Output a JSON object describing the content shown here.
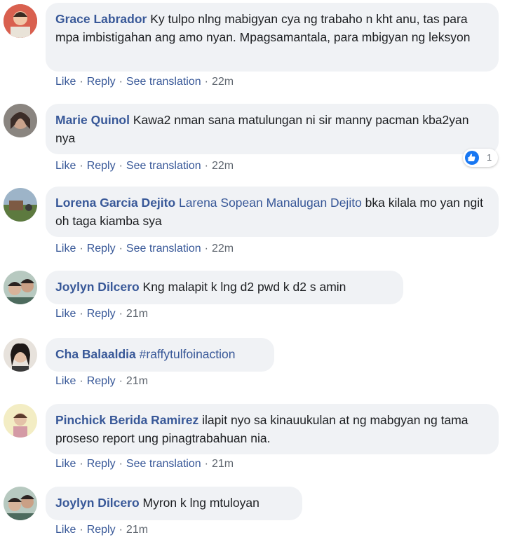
{
  "actions": {
    "like": "Like",
    "reply": "Reply",
    "see_translation": "See translation"
  },
  "comments": [
    {
      "author": "Grace Labrador",
      "text": "Ky tulpo nlng mabigyan cya ng trabaho n kht anu, tas para mpa imbistigahan ang amo nyan. Mpagsamantala, para mbigyan ng leksyon",
      "time": "22m"
    },
    {
      "author": "Marie Quinol",
      "text": "Kawa2 nman sana matulungan ni sir manny pacman kba2yan nya",
      "time": "22m",
      "reaction_count": "1"
    },
    {
      "author": "Lorena Garcia Dejito",
      "tagged": "Larena Sopean Manalugan Dejito",
      "text": "bka kilala mo yan ngit oh taga kiamba sya",
      "time": "22m"
    },
    {
      "author": "Joylyn Dilcero",
      "text": "Kng malapit k lng d2 pwd k d2 s amin",
      "time": "21m"
    },
    {
      "author": "Cha Balaaldia",
      "tagged": "#raffytulfoinaction",
      "time": "21m"
    },
    {
      "author": "Pinchick Berida Ramirez",
      "text": "ilapit nyo sa kinauukulan at ng mabgyan ng tama proseso report ung pinagtrabahuan nia.",
      "time": "21m"
    },
    {
      "author": "Joylyn Dilcero",
      "text": "Myron k lng mtuloyan",
      "time": "21m"
    }
  ]
}
